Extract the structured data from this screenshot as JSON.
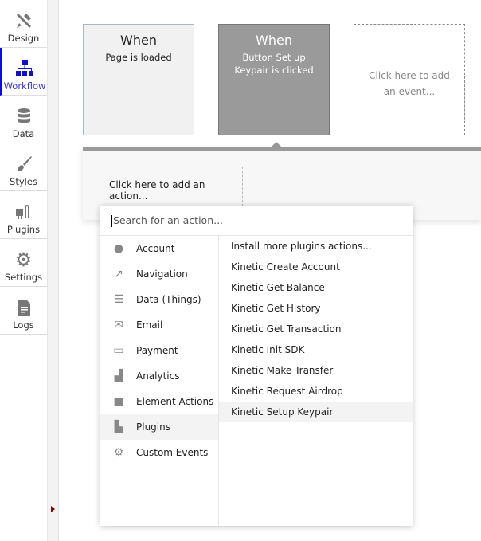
{
  "sidebar": {
    "items": [
      {
        "label": "Design"
      },
      {
        "label": "Workflow"
      },
      {
        "label": "Data"
      },
      {
        "label": "Styles"
      },
      {
        "label": "Plugins"
      },
      {
        "label": "Settings"
      },
      {
        "label": "Logs"
      }
    ],
    "active": "Workflow",
    "accent": "#0d0dd8"
  },
  "events": [
    {
      "when": "When",
      "desc": "Page is loaded"
    },
    {
      "when": "When",
      "desc": "Button Set up Keypair is clicked"
    },
    {
      "desc": "Click here to add an event..."
    }
  ],
  "add_action": "Click here to add an action...",
  "dropdown": {
    "search_placeholder": "Search for an action...",
    "categories": [
      {
        "label": "Account"
      },
      {
        "label": "Navigation"
      },
      {
        "label": "Data (Things)"
      },
      {
        "label": "Email"
      },
      {
        "label": "Payment"
      },
      {
        "label": "Analytics"
      },
      {
        "label": "Element Actions"
      },
      {
        "label": "Plugins"
      },
      {
        "label": "Custom Events"
      }
    ],
    "actions": [
      {
        "label": "Install more plugins actions..."
      },
      {
        "label": "Kinetic Create Account"
      },
      {
        "label": "Kinetic Get Balance"
      },
      {
        "label": "Kinetic Get History"
      },
      {
        "label": "Kinetic Get Transaction"
      },
      {
        "label": "Kinetic Init SDK"
      },
      {
        "label": "Kinetic Make Transfer"
      },
      {
        "label": "Kinetic Request Airdrop"
      },
      {
        "label": "Kinetic Setup Keypair"
      }
    ]
  }
}
